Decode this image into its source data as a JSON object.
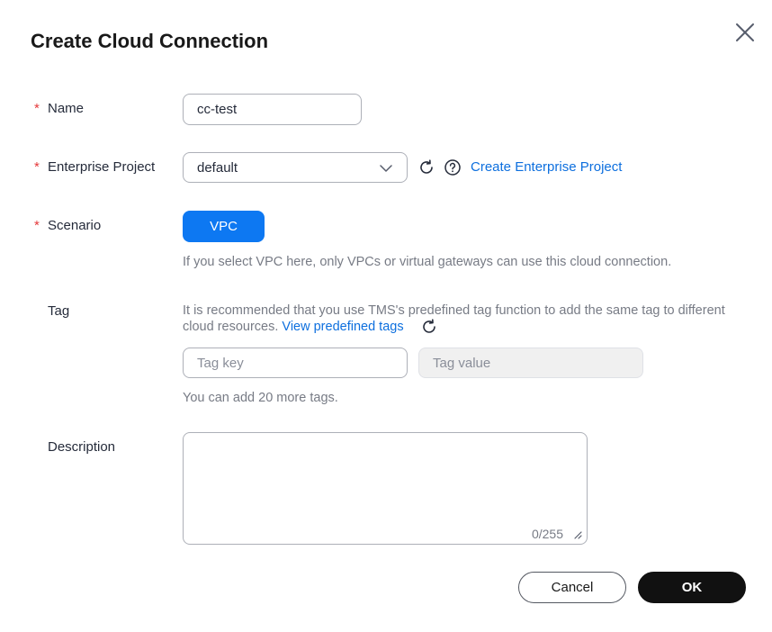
{
  "dialog": {
    "title": "Create Cloud Connection"
  },
  "form": {
    "required_mark": "*",
    "name": {
      "label": "Name",
      "value": "cc-test"
    },
    "enterprise_project": {
      "label": "Enterprise Project",
      "selected": "default",
      "create_link": "Create Enterprise Project"
    },
    "scenario": {
      "label": "Scenario",
      "button": "VPC",
      "hint": "If you select VPC here, only VPCs or virtual gateways can use this cloud connection."
    },
    "tag": {
      "label": "Tag",
      "hint_line1": "It is recommended that you use TMS's predefined tag function to add the same tag to different",
      "hint_line2": "cloud resources.",
      "view_link": "View predefined tags",
      "key_placeholder": "Tag key",
      "value_placeholder": "Tag value",
      "remaining": "You can add 20 more tags."
    },
    "description": {
      "label": "Description",
      "value": "",
      "counter": "0/255"
    }
  },
  "footer": {
    "cancel_label": "Cancel",
    "ok_label": "OK"
  },
  "colors": {
    "primary": "#0d78f2",
    "link": "#0d6fde",
    "required": "#e5393b",
    "ok_button": "#111111"
  },
  "icons": {
    "close": "close-icon",
    "refresh": "refresh-icon",
    "help": "help-icon",
    "chevron": "chevron-down-icon"
  }
}
